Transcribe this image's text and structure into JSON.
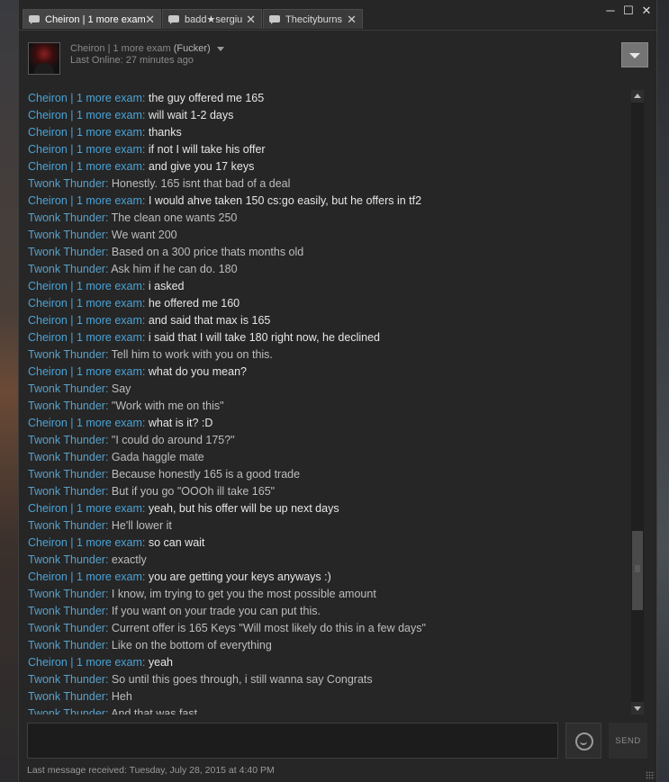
{
  "tabs": [
    {
      "label": "Cheiron | 1 more exam",
      "active": true
    },
    {
      "label": "badd★sergiu",
      "active": false
    },
    {
      "label": "Thecityburns",
      "active": false
    }
  ],
  "window_controls": {
    "minimize": "─",
    "maximize": "☐",
    "close": "✕"
  },
  "header": {
    "friend_name": "Cheiron | 1 more exam",
    "nickname": "(Fucker)",
    "last_online": "Last Online: 27 minutes ago"
  },
  "messages": [
    {
      "author": "Cheiron | 1 more exam",
      "text": "the guy offered me 165"
    },
    {
      "author": "Cheiron | 1 more exam",
      "text": "will wait 1-2 days"
    },
    {
      "author": "Cheiron | 1 more exam",
      "text": "thanks"
    },
    {
      "author": "Cheiron | 1 more exam",
      "text": "if not I will take his offer"
    },
    {
      "author": "Cheiron | 1 more exam",
      "text": "and give you 17 keys"
    },
    {
      "author": "Twonk Thunder",
      "text": "Honestly. 165 isnt that bad of a deal"
    },
    {
      "author": "Cheiron | 1 more exam",
      "text": "I would ahve taken 150 cs:go easily, but he offers in tf2"
    },
    {
      "author": "Twonk Thunder",
      "text": "The clean one wants 250"
    },
    {
      "author": "Twonk Thunder",
      "text": "We want 200"
    },
    {
      "author": "Twonk Thunder",
      "text": "Based on a 300 price thats months old"
    },
    {
      "author": "Twonk Thunder",
      "text": "Ask him if he can do. 180"
    },
    {
      "author": "Cheiron | 1 more exam",
      "text": "i asked"
    },
    {
      "author": "Cheiron | 1 more exam",
      "text": "he offered me 160"
    },
    {
      "author": "Cheiron | 1 more exam",
      "text": "and said that max is 165"
    },
    {
      "author": "Cheiron | 1 more exam",
      "text": "i said that I will take 180 right now, he declined"
    },
    {
      "author": "Twonk Thunder",
      "text": "Tell him to work with you on this."
    },
    {
      "author": "Cheiron | 1 more exam",
      "text": "what do you mean?"
    },
    {
      "author": "Twonk Thunder",
      "text": "Say"
    },
    {
      "author": "Twonk Thunder",
      "text": "\"Work with me on this\""
    },
    {
      "author": "Cheiron | 1 more exam",
      "text": "what is it? :D"
    },
    {
      "author": "Twonk Thunder",
      "text": "\"I could do around 175?\""
    },
    {
      "author": "Twonk Thunder",
      "text": "Gada haggle mate"
    },
    {
      "author": "Twonk Thunder",
      "text": "Because honestly 165 is a good trade"
    },
    {
      "author": "Twonk Thunder",
      "text": "But if you go \"OOOh ill take 165\""
    },
    {
      "author": "Cheiron | 1 more exam",
      "text": "yeah, but his offer will be up next days"
    },
    {
      "author": "Twonk Thunder",
      "text": "He'll lower it"
    },
    {
      "author": "Cheiron | 1 more exam",
      "text": "so can wait"
    },
    {
      "author": "Twonk Thunder",
      "text": "exactly"
    },
    {
      "author": "Cheiron | 1 more exam",
      "text": "you are getting your keys anyways :)"
    },
    {
      "author": "Twonk Thunder",
      "text": "I know, im trying to get you the most possible amount"
    },
    {
      "author": "Twonk Thunder",
      "text": "If you want on your trade you can put this."
    },
    {
      "author": "Twonk Thunder",
      "text": "Current offer is 165 Keys \"Will most likely do this in a few days\""
    },
    {
      "author": "Twonk Thunder",
      "text": "Like on the bottom of everything"
    },
    {
      "author": "Cheiron | 1 more exam",
      "text": "yeah"
    },
    {
      "author": "Twonk Thunder",
      "text": "So until this goes through, i still wanna say Congrats"
    },
    {
      "author": "Twonk Thunder",
      "text": "Heh"
    },
    {
      "author": "Twonk Thunder",
      "text": "And that was fast"
    }
  ],
  "composer": {
    "placeholder": "",
    "send_label": "SEND"
  },
  "status_text": "Last message received: Tuesday, July 28, 2015 at 4:40 PM",
  "colors": {
    "friend_name": "#4ba3d6",
    "background": "#262626"
  }
}
